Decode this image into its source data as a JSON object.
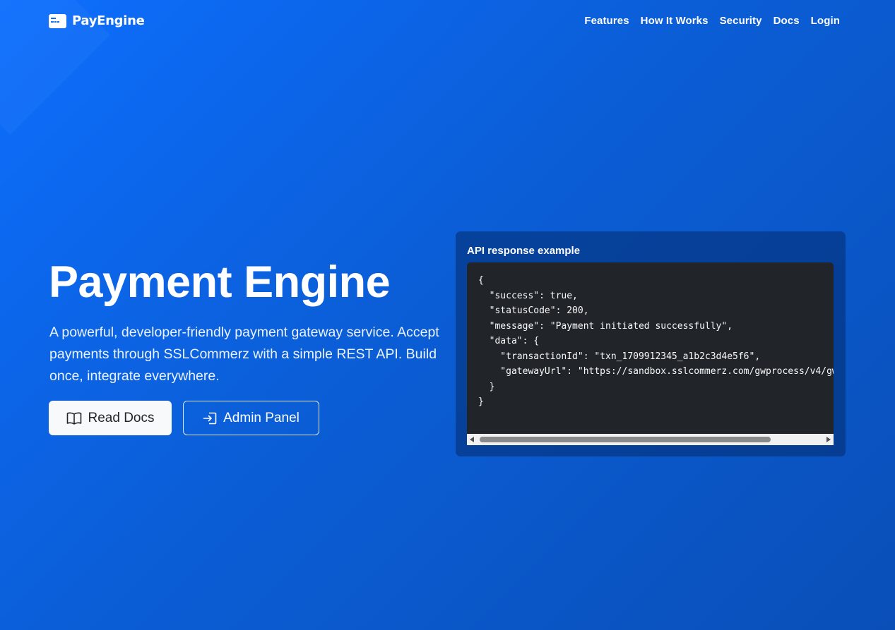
{
  "brand": {
    "name": "PayEngine",
    "icon": "credit-card-icon"
  },
  "nav": {
    "items": [
      {
        "label": "Features"
      },
      {
        "label": "How It Works"
      },
      {
        "label": "Security"
      },
      {
        "label": "Docs"
      },
      {
        "label": "Login"
      }
    ]
  },
  "hero": {
    "title": "Payment Engine",
    "description": "A powerful, developer-friendly payment gateway service. Accept payments through SSLCommerz with a simple REST API. Build once, integrate everywhere.",
    "buttons": {
      "read_docs": {
        "label": "Read Docs",
        "icon": "book-icon"
      },
      "admin_panel": {
        "label": "Admin Panel",
        "icon": "login-icon"
      }
    }
  },
  "api_example": {
    "title": "API response example",
    "code": "{\n  \"success\": true,\n  \"statusCode\": 200,\n  \"message\": \"Payment initiated successfully\",\n  \"data\": {\n    \"transactionId\": \"txn_1709912345_a1b2c3d4e5f6\",\n    \"gatewayUrl\": \"https://sandbox.sslcommerz.com/gwprocess/v4/gw\n  }\n}"
  },
  "colors": {
    "background": "#0d6efd",
    "code_background": "#212529",
    "light_button": "#f8f9fa"
  }
}
